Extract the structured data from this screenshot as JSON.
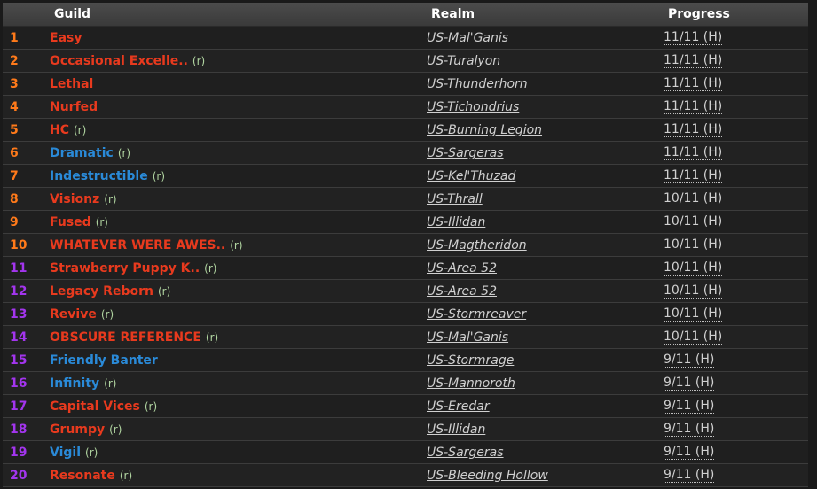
{
  "headers": {
    "guild": "Guild",
    "realm": "Realm",
    "progress": "Progress"
  },
  "rows": [
    {
      "rank": "1",
      "guild": "Easy",
      "rec": "",
      "realm": "US-Mal'Ganis",
      "progress": "11/11 (H)",
      "rankColor": "#ff7a1a",
      "guildColor": "#e83a1e"
    },
    {
      "rank": "2",
      "guild": "Occasional Excelle..",
      "rec": "(r)",
      "realm": "US-Turalyon",
      "progress": "11/11 (H)",
      "rankColor": "#ff7a1a",
      "guildColor": "#e83a1e"
    },
    {
      "rank": "3",
      "guild": "Lethal",
      "rec": "",
      "realm": "US-Thunderhorn",
      "progress": "11/11 (H)",
      "rankColor": "#ff7a1a",
      "guildColor": "#e83a1e"
    },
    {
      "rank": "4",
      "guild": "Nurfed",
      "rec": "",
      "realm": "US-Tichondrius",
      "progress": "11/11 (H)",
      "rankColor": "#ff7a1a",
      "guildColor": "#e83a1e"
    },
    {
      "rank": "5",
      "guild": "HC",
      "rec": "(r)",
      "realm": "US-Burning Legion",
      "progress": "11/11 (H)",
      "rankColor": "#ff7a1a",
      "guildColor": "#e83a1e"
    },
    {
      "rank": "6",
      "guild": "Dramatic",
      "rec": "(r)",
      "realm": "US-Sargeras",
      "progress": "11/11 (H)",
      "rankColor": "#ff7a1a",
      "guildColor": "#2a8ad8"
    },
    {
      "rank": "7",
      "guild": "Indestructible",
      "rec": "(r)",
      "realm": "US-Kel'Thuzad",
      "progress": "11/11 (H)",
      "rankColor": "#ff7a1a",
      "guildColor": "#2a8ad8"
    },
    {
      "rank": "8",
      "guild": "Visionz",
      "rec": "(r)",
      "realm": "US-Thrall",
      "progress": "10/11 (H)",
      "rankColor": "#ff7a1a",
      "guildColor": "#e83a1e"
    },
    {
      "rank": "9",
      "guild": "Fused",
      "rec": "(r)",
      "realm": "US-Illidan",
      "progress": "10/11 (H)",
      "rankColor": "#ff7a1a",
      "guildColor": "#e83a1e"
    },
    {
      "rank": "10",
      "guild": "WHATEVER WERE AWES..",
      "rec": "(r)",
      "realm": "US-Magtheridon",
      "progress": "10/11 (H)",
      "rankColor": "#ff7a1a",
      "guildColor": "#e83a1e"
    },
    {
      "rank": "11",
      "guild": "Strawberry Puppy K..",
      "rec": "(r)",
      "realm": "US-Area 52",
      "progress": "10/11 (H)",
      "rankColor": "#a335ee",
      "guildColor": "#e83a1e"
    },
    {
      "rank": "12",
      "guild": "Legacy Reborn",
      "rec": "(r)",
      "realm": "US-Area 52",
      "progress": "10/11 (H)",
      "rankColor": "#a335ee",
      "guildColor": "#e83a1e"
    },
    {
      "rank": "13",
      "guild": "Revive",
      "rec": "(r)",
      "realm": "US-Stormreaver",
      "progress": "10/11 (H)",
      "rankColor": "#a335ee",
      "guildColor": "#e83a1e"
    },
    {
      "rank": "14",
      "guild": "OBSCURE REFERENCE",
      "rec": "(r)",
      "realm": "US-Mal'Ganis",
      "progress": "10/11 (H)",
      "rankColor": "#a335ee",
      "guildColor": "#e83a1e"
    },
    {
      "rank": "15",
      "guild": "Friendly Banter",
      "rec": "",
      "realm": "US-Stormrage",
      "progress": "9/11 (H)",
      "rankColor": "#a335ee",
      "guildColor": "#2a8ad8"
    },
    {
      "rank": "16",
      "guild": "Infinity",
      "rec": "(r)",
      "realm": "US-Mannoroth",
      "progress": "9/11 (H)",
      "rankColor": "#a335ee",
      "guildColor": "#2a8ad8"
    },
    {
      "rank": "17",
      "guild": "Capital Vices",
      "rec": "(r)",
      "realm": "US-Eredar",
      "progress": "9/11 (H)",
      "rankColor": "#a335ee",
      "guildColor": "#e83a1e"
    },
    {
      "rank": "18",
      "guild": "Grumpy",
      "rec": "(r)",
      "realm": "US-Illidan",
      "progress": "9/11 (H)",
      "rankColor": "#a335ee",
      "guildColor": "#e83a1e"
    },
    {
      "rank": "19",
      "guild": "Vigil",
      "rec": "(r)",
      "realm": "US-Sargeras",
      "progress": "9/11 (H)",
      "rankColor": "#a335ee",
      "guildColor": "#2a8ad8"
    },
    {
      "rank": "20",
      "guild": "Resonate",
      "rec": "(r)",
      "realm": "US-Bleeding Hollow",
      "progress": "9/11 (H)",
      "rankColor": "#a335ee",
      "guildColor": "#e83a1e"
    }
  ]
}
